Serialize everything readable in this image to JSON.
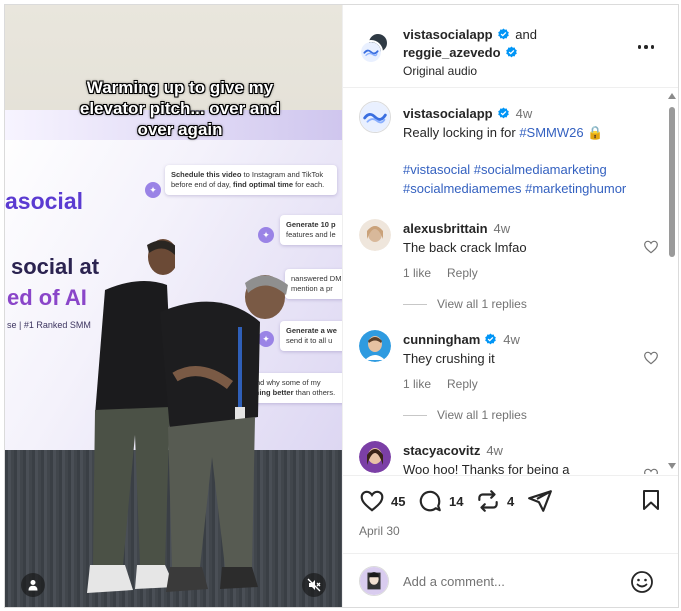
{
  "media": {
    "caption_overlay": "Warming up to give my elevator pitch... over and over again",
    "backdrop": {
      "brand": "asocial",
      "slogan_line1": "social at",
      "slogan_line2": "ed of AI",
      "ranked": "se  |  #1 Ranked SMM",
      "cards": [
        {
          "pre": "Schedule this video",
          "mid": " to Instagram and TikTok before end of day, ",
          "bold": "find optimal time",
          "post": " for each."
        },
        {
          "pre": "Generate 10 p",
          "mid": " features and le",
          "bold": "",
          "post": ""
        },
        {
          "pre": "",
          "mid": "nanswered DM mention a pr",
          "bold": "",
          "post": ""
        },
        {
          "pre": "Generate a we",
          "mid": " send it to all u",
          "bold": "",
          "post": ""
        },
        {
          "pre": "",
          "mid": "nderstand why some of my",
          "bold": " performing better",
          "post": " than others."
        }
      ]
    }
  },
  "header": {
    "username1": "vistasocialapp",
    "connector": "and",
    "username2": "reggie_azevedo",
    "audio": "Original audio"
  },
  "caption": {
    "username": "vistasocialapp",
    "time": "4w",
    "text": "Really locking in for ",
    "hashtag_event": "#SMMW26",
    "emoji": "🔒",
    "hashtags_line1": "#vistasocial #socialmediamarketing",
    "hashtags_line2": "#socialmediamemes #marketinghumor"
  },
  "comments": [
    {
      "username": "alexusbrittain",
      "time": "4w",
      "text": "The back crack lmfao",
      "likes": "1 like",
      "reply": "Reply",
      "view_replies": "View all 1 replies",
      "verified": false
    },
    {
      "username": "cunningham",
      "time": "4w",
      "text": "They crushing it",
      "likes": "1 like",
      "reply": "Reply",
      "view_replies": "View all 1 replies",
      "verified": true
    },
    {
      "username": "stacyacovitz",
      "time": "4w",
      "text": "Woo hoo! Thanks for being a",
      "verified": false
    }
  ],
  "actions": {
    "likes": "45",
    "comments": "14",
    "reposts": "4",
    "date": "April 30"
  },
  "add_comment": {
    "placeholder": "Add a comment..."
  },
  "colors": {
    "verified": "#0095f6",
    "link": "#3461c0",
    "brand_purple": "#5b3bd1"
  },
  "icons": [
    "verified-icon",
    "more-icon",
    "heart-icon",
    "comment-icon",
    "repost-icon",
    "share-icon",
    "bookmark-icon",
    "emoji-icon",
    "user-tag-icon",
    "mute-icon",
    "lock-emoji"
  ]
}
